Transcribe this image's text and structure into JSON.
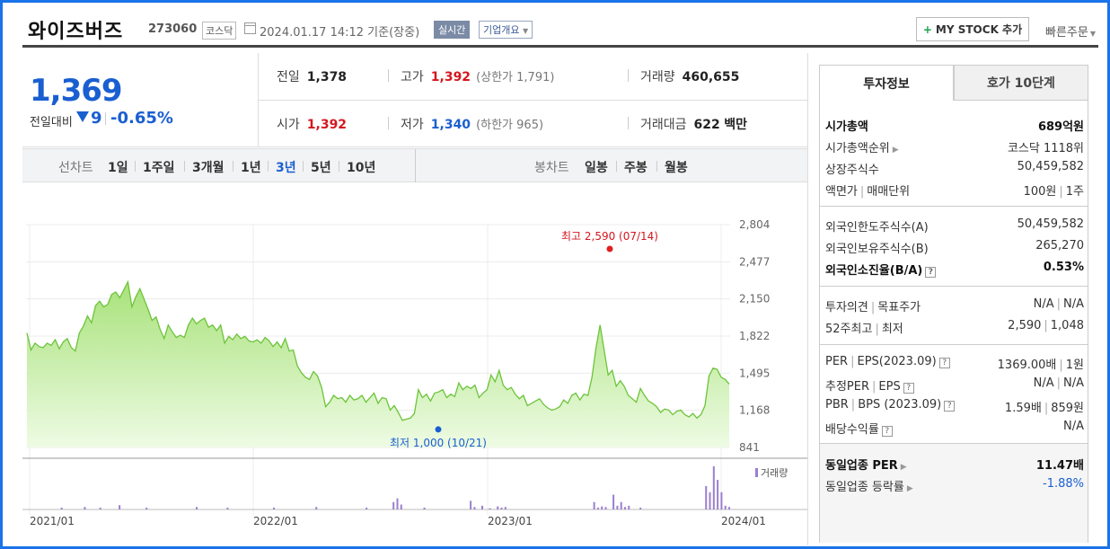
{
  "header": {
    "name": "와이즈버즈",
    "code": "273060",
    "market": "코스닥",
    "date": "2024.01.17 14:12",
    "date_suffix": "기준(장중)",
    "realtime": "실시간",
    "company_info": "기업개요",
    "my_stock": "MY STOCK 추가",
    "quick_order": "빠른주문"
  },
  "price": {
    "current": "1,369",
    "compare_label": "전일대비",
    "change": "9",
    "change_pct": "-0.65%",
    "prev_close_label": "전일",
    "prev_close": "1,378",
    "high_label": "고가",
    "high": "1,392",
    "upper_limit": "(상한가 1,791)",
    "volume_label": "거래량",
    "volume": "460,655",
    "open_label": "시가",
    "open": "1,392",
    "low_label": "저가",
    "low": "1,340",
    "lower_limit": "(하한가 965)",
    "amount_label": "거래대금",
    "amount": "622",
    "amount_unit": "백만"
  },
  "period": {
    "line_label": "선차트",
    "line_options": [
      "1일",
      "1주일",
      "3개월",
      "1년",
      "3년",
      "5년",
      "10년"
    ],
    "selected": "3년",
    "candle_label": "봉차트",
    "candle_options": [
      "일봉",
      "주봉",
      "월봉"
    ]
  },
  "chart_data": {
    "type": "area",
    "y_ticks": [
      "2,804",
      "2,477",
      "2,150",
      "1,822",
      "1,495",
      "1,168",
      "841"
    ],
    "ylim": [
      841,
      2804
    ],
    "x_ticks": [
      "2021/01",
      "2022/01",
      "2023/01",
      "2024/01"
    ],
    "high_label": "최고 2,590 (07/14)",
    "high_value": 2590,
    "low_label": "최저 1,000 (10/21)",
    "low_value": 1000,
    "volume_legend": "거래량",
    "series": [
      {
        "values": [
          1850,
          1700,
          1760,
          1730,
          1720,
          1760,
          1740,
          1790,
          1710,
          1770,
          1800,
          1720,
          1690,
          1850,
          1910,
          2000,
          1940,
          2090,
          2130,
          2080,
          2100,
          2190,
          2210,
          2160,
          2230,
          2300,
          2080,
          2170,
          2240,
          2150,
          2060,
          1960,
          1990,
          1880,
          1800,
          1920,
          1860,
          1810,
          1830,
          1810,
          1920,
          1980,
          1930,
          1960,
          1980,
          1900,
          1920,
          1870,
          1920,
          1760,
          1820,
          1790,
          1840,
          1800,
          1820,
          1780,
          1770,
          1790,
          1760,
          1810,
          1780,
          1730,
          1770,
          1720,
          1800,
          1690,
          1700,
          1560,
          1500,
          1460,
          1440,
          1510,
          1470,
          1370,
          1200,
          1240,
          1300,
          1270,
          1280,
          1240,
          1300,
          1260,
          1270,
          1300,
          1240,
          1280,
          1320,
          1230,
          1280,
          1270,
          1170,
          1210,
          1150,
          1080,
          1090,
          1100,
          1140,
          1350,
          1280,
          1310,
          1250,
          1320,
          1330,
          1350,
          1280,
          1310,
          1290,
          1410,
          1350,
          1380,
          1360,
          1390,
          1280,
          1320,
          1350,
          1480,
          1420,
          1520,
          1390,
          1350,
          1370,
          1310,
          1270,
          1300,
          1210,
          1230,
          1250,
          1270,
          1220,
          1190,
          1170,
          1180,
          1200,
          1260,
          1230,
          1300,
          1320,
          1260,
          1310,
          1300,
          1460,
          1720,
          1920,
          1700,
          1480,
          1520,
          1380,
          1430,
          1380,
          1300,
          1270,
          1240,
          1360,
          1300,
          1250,
          1230,
          1200,
          1150,
          1180,
          1170,
          1130,
          1160,
          1170,
          1130,
          1110,
          1140,
          1100,
          1130,
          1210,
          1470,
          1540,
          1530,
          1460,
          1440,
          1400
        ]
      }
    ],
    "volume": [
      0,
      0,
      0,
      0,
      0,
      0,
      0,
      0,
      0,
      3,
      0,
      0,
      0,
      0,
      0,
      4,
      0,
      0,
      0,
      3,
      0,
      0,
      0,
      0,
      7,
      0,
      0,
      0,
      0,
      0,
      0,
      3,
      0,
      0,
      0,
      0,
      0,
      0,
      0,
      0,
      0,
      0,
      0,
      0,
      4,
      0,
      0,
      0,
      0,
      0,
      0,
      0,
      3,
      0,
      0,
      0,
      0,
      0,
      0,
      0,
      0,
      0,
      0,
      0,
      3,
      0,
      0,
      0,
      0,
      0,
      0,
      0,
      0,
      0,
      0,
      4,
      0,
      0,
      0,
      0,
      0,
      0,
      0,
      0,
      0,
      0,
      0,
      0,
      3,
      0,
      0,
      0,
      0,
      0,
      0,
      12,
      18,
      8,
      0,
      0,
      0,
      0,
      0,
      3,
      0,
      0,
      0,
      0,
      0,
      0,
      0,
      0,
      0,
      0,
      0,
      14,
      4,
      0,
      6,
      0,
      2,
      0,
      5,
      3,
      4,
      0,
      0,
      0,
      0,
      0,
      0,
      0,
      0,
      0,
      0,
      0,
      0,
      0,
      0,
      0,
      0,
      0,
      0,
      0,
      0,
      0,
      0,
      12,
      3,
      5,
      4,
      0,
      24,
      6,
      12,
      4,
      6,
      0,
      0,
      3,
      0,
      0,
      0,
      0,
      0,
      0,
      0,
      0,
      0,
      0,
      0,
      0,
      0,
      0,
      0,
      0,
      38,
      28,
      70,
      48,
      28,
      6,
      4
    ]
  },
  "panel": {
    "tab_invest": "투자정보",
    "tab_quote": "호가 10단계",
    "market_cap_label": "시가총액",
    "market_cap": "689억원",
    "cap_rank_label": "시가총액순위",
    "cap_rank": "코스닥 1118위",
    "shares_label": "상장주식수",
    "shares": "50,459,582",
    "par_label": "액면가",
    "lot_label": "매매단위",
    "par": "100원",
    "lot": "1주",
    "foreign_limit_label": "외국인한도주식수(A)",
    "foreign_limit": "50,459,582",
    "foreign_hold_label": "외국인보유주식수(B)",
    "foreign_hold": "265,270",
    "foreign_ratio_label": "외국인소진율(B/A)",
    "foreign_ratio": "0.53%",
    "opinion_label": "투자의견",
    "target_label": "목표주가",
    "opinion": "N/A",
    "target": "N/A",
    "w52_label": "52주최고",
    "w52_low_label": "최저",
    "w52_high": "2,590",
    "w52_low": "1,048",
    "per_label": "PER",
    "eps_label": "EPS(2023.09)",
    "per": "1369.00배",
    "eps": "1원",
    "eper_label": "추정PER",
    "eeps_label": "EPS",
    "eper": "N/A",
    "eeps": "N/A",
    "pbr_label": "PBR",
    "bps_label": "BPS (2023.09)",
    "pbr": "1.59배",
    "bps": "859원",
    "div_label": "배당수익률",
    "div": "N/A",
    "ind_per_label": "동일업종 PER",
    "ind_per": "11.47배",
    "ind_rate_label": "동일업종 등락률",
    "ind_rate": "-1.88%"
  }
}
